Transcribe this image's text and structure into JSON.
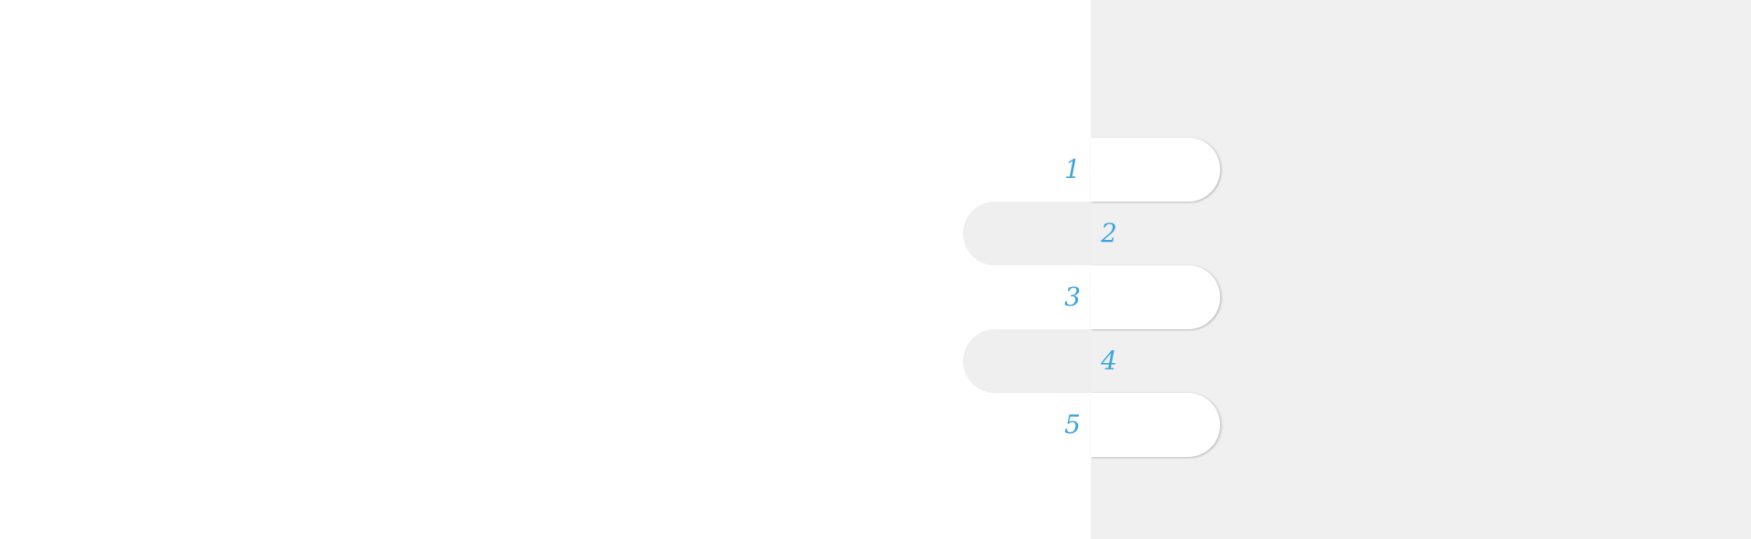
{
  "colors": {
    "page_background": "#ffffff",
    "panel_background": "#f0f0f0",
    "pill_on_panel": "#ffffff",
    "pill_on_page": "#efefef",
    "number_color": "#3aa6dc"
  },
  "steps": [
    {
      "label": "1"
    },
    {
      "label": "2"
    },
    {
      "label": "3"
    },
    {
      "label": "4"
    },
    {
      "label": "5"
    }
  ]
}
